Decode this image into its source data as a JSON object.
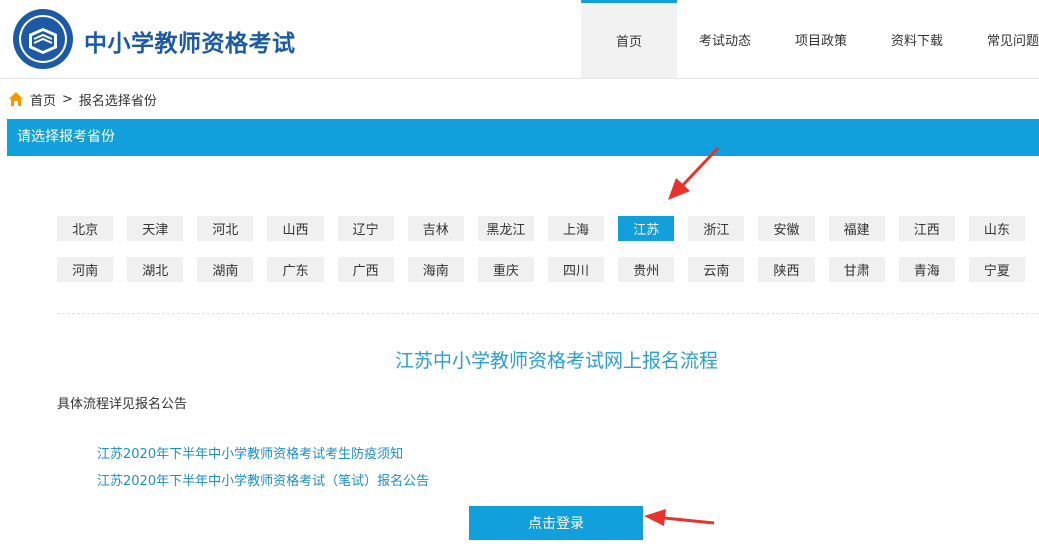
{
  "header": {
    "site_title": "中小学教师资格考试",
    "nav": [
      "首页",
      "考试动态",
      "项目政策",
      "资料下载",
      "常见问题"
    ],
    "active_nav": "首页"
  },
  "breadcrumb": {
    "home": "首页",
    "separator": ">",
    "current": "报名选择省份"
  },
  "panel": {
    "title": "请选择报考省份"
  },
  "provinces": {
    "selected": "江苏",
    "rows": [
      [
        "北京",
        "天津",
        "河北",
        "山西",
        "辽宁",
        "吉林",
        "黑龙江",
        "上海",
        "江苏",
        "浙江",
        "安徽",
        "福建",
        "江西",
        "山东"
      ],
      [
        "河南",
        "湖北",
        "湖南",
        "广东",
        "广西",
        "海南",
        "重庆",
        "四川",
        "贵州",
        "云南",
        "陕西",
        "甘肃",
        "青海",
        "宁夏"
      ]
    ]
  },
  "content": {
    "flow_title": "江苏中小学教师资格考试网上报名流程",
    "detail_note": "具体流程详见报名公告",
    "links": [
      "江苏2020年下半年中小学教师资格考试考生防疫须知",
      "江苏2020年下半年中小学教师资格考试（笔试）报名公告"
    ],
    "login_label": "点击登录"
  },
  "colors": {
    "accent": "#11a0db",
    "title_blue": "#1c5aa6",
    "link_blue": "#1a8fd0",
    "annotation_red": "#e8322c"
  }
}
